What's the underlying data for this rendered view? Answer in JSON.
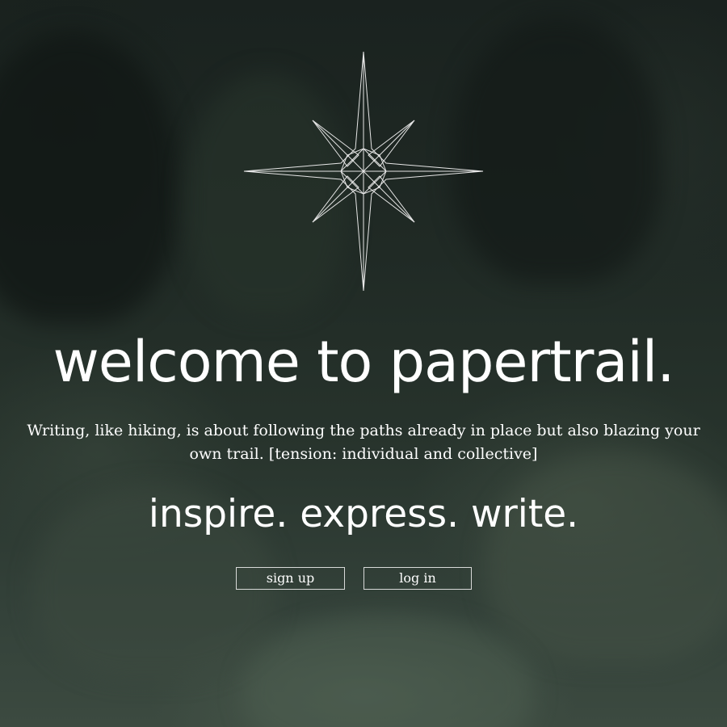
{
  "hero": {
    "background": "forest-photo",
    "headline": "welcome to papertrail.",
    "intro": "Writing, like hiking, is about following the paths already in place but also blazing your own trail. [tension: individual and collective]",
    "tagline": "inspire. express. write."
  },
  "logo": {
    "icon": "compass-star-icon"
  },
  "actions": {
    "signup_label": "sign up",
    "login_label": "log in"
  },
  "colors": {
    "text": "#ffffff",
    "button_border": "#ebebeb",
    "background": "#222b26"
  }
}
